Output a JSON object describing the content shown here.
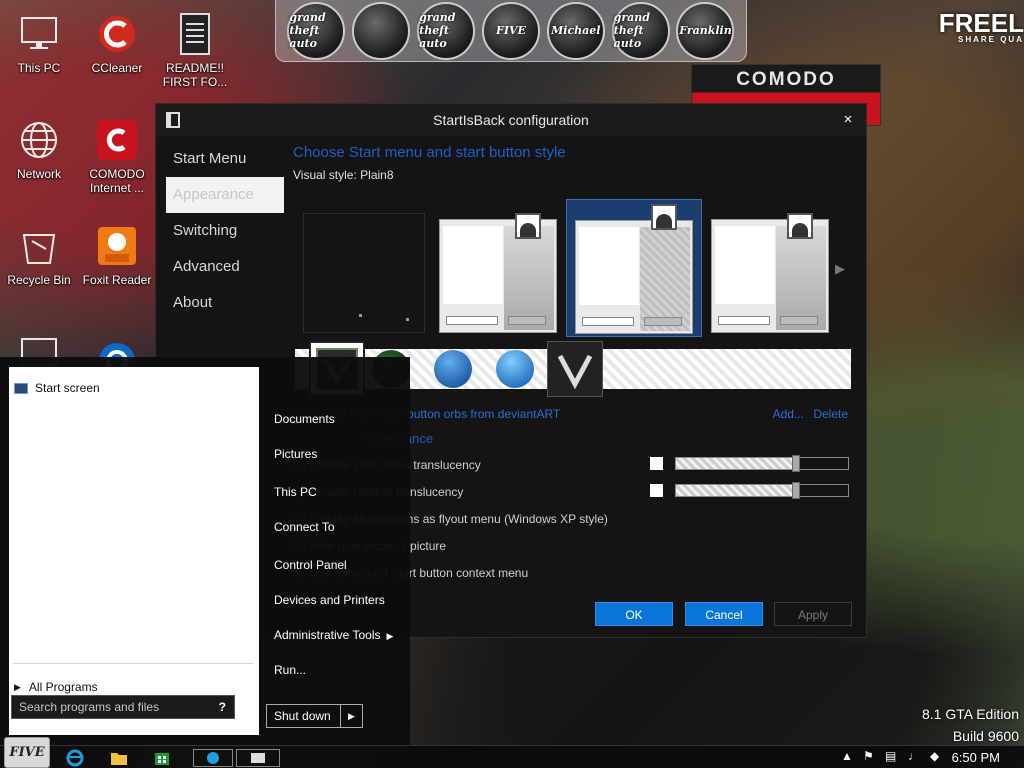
{
  "desktop": {
    "icons": [
      {
        "label": "This PC",
        "icon": "monitor-icon"
      },
      {
        "label": "CCleaner",
        "icon": "ccleaner-icon"
      },
      {
        "label": "README!! FIRST FO...",
        "icon": "text-document-icon"
      },
      {
        "label": "Network",
        "icon": "network-globe-icon"
      },
      {
        "label": "COMODO Internet ...",
        "icon": "comodo-icon"
      },
      {
        "label": "Recycle Bin",
        "icon": "recycle-bin-icon"
      },
      {
        "label": "Foxit Reader",
        "icon": "foxit-reader-icon"
      }
    ],
    "dock_labels": [
      "grand theft auto",
      "",
      "grand theft auto",
      "FIVE",
      "Michael",
      "grand theft auto",
      "Franklin"
    ],
    "brand_text": "FREEL",
    "brand_sub": "SHARE QUA",
    "comodo_text": "COMODO",
    "edition_line1": "8.1 GTA Edition",
    "edition_line2": "Build 9600"
  },
  "window": {
    "title": "StartIsBack configuration",
    "close_glyph": "×",
    "nav": [
      "Start Menu",
      "Appearance",
      "Switching",
      "Advanced",
      "About"
    ],
    "active_nav": "Appearance",
    "heading": "Choose Start menu and start button style",
    "visual_style_label": "Visual style:",
    "visual_style_value": "Plain8",
    "orbs_link": "Download more start button orbs from deviantART",
    "add_label": "Add...",
    "delete_label": "Delete",
    "appearance_heading": "Appearance",
    "options": [
      "Disable start menu translucency",
      "Disable taskbar translucency",
      "Display All programs as flyout menu (Windows XP style)",
      "Hide user account picture",
      "Use enhanced Start button context menu"
    ],
    "slider_1_level": 0.7,
    "slider_2_level": 0.7,
    "ok_label": "OK",
    "cancel_label": "Cancel",
    "apply_label": "Apply"
  },
  "start_menu": {
    "start_screen_label": "Start screen",
    "all_programs_label": "All Programs",
    "search_placeholder": "Search programs and files",
    "search_icon_glyph": "?",
    "right_items": [
      "Documents",
      "Pictures",
      "This PC",
      "Connect To",
      "Control Panel",
      "Devices and Printers",
      "Administrative Tools",
      "Run..."
    ],
    "shutdown_label": "Shut down"
  },
  "taskbar": {
    "start_orb_label": "FIVE",
    "clock": "6:50 PM"
  },
  "colors": {
    "accent_blue": "#0a74d8",
    "heading_blue": "#1e5fc8",
    "link_blue": "#2a6fd8",
    "comodo_red": "#c8141e"
  }
}
